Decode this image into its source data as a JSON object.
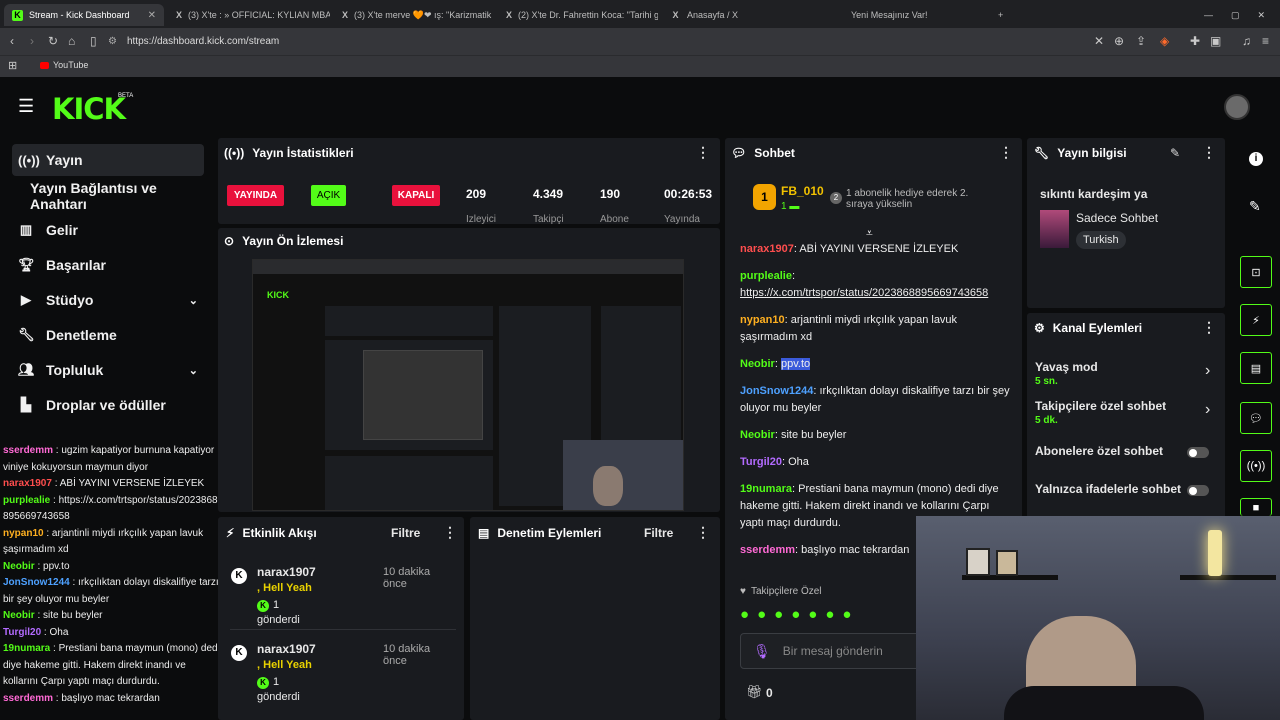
{
  "browser": {
    "tabs": [
      {
        "title": "Stream - Kick Dashboard",
        "active": true
      },
      {
        "title": "(3) X'te : » OFFICIAL: KYLIAN MBA"
      },
      {
        "title": "(3) X'te merve 🧡❤ ış: \"Karizmatik Ce"
      },
      {
        "title": "(2) X'te Dr. Fahrettin Koca: \"Tarihi gal"
      },
      {
        "title": "Anasayfa / X"
      },
      {
        "title": "Yeni Mesajınız Var!"
      }
    ],
    "url": "https://dashboard.kick.com/stream",
    "bookmark": "YouTube"
  },
  "header": {
    "logo": "KICK",
    "beta": "BETA"
  },
  "sidebar": {
    "items": [
      {
        "label": "Yayın"
      },
      {
        "label": "Yayın Bağlantısı ve Anahtarı"
      },
      {
        "label": "Gelir"
      },
      {
        "label": "Başarılar"
      },
      {
        "label": "Stüdyo"
      },
      {
        "label": "Denetleme"
      },
      {
        "label": "Topluluk"
      },
      {
        "label": "Droplar ve ödüller"
      }
    ]
  },
  "stats": {
    "title": "Yayın İstatistikleri",
    "live": "YAYINDA",
    "open": "AÇIK",
    "closed": "KAPALI",
    "viewers": "209",
    "viewers_label": "İzleyici",
    "followers": "4.349",
    "followers_label": "Takipçi",
    "subs": "190",
    "subs_label": "Abone",
    "duration": "00:26:53",
    "duration_label": "Yayında"
  },
  "preview": {
    "title": "Yayın Ön İzlemesi"
  },
  "events": {
    "title": "Etkinlik Akışı",
    "filter": "Filtre",
    "items": [
      {
        "user": "narax1907",
        "time": "10 dakika önce",
        "kicks": "Hell Yeah",
        "count": "1",
        "sent": "gönderdi"
      },
      {
        "user": "narax1907",
        "time": "10 dakika önce",
        "kicks": "Hell Yeah",
        "count": "1",
        "sent": "gönderdi"
      }
    ]
  },
  "moderation": {
    "title": "Denetim Eylemleri",
    "filter": "Filtre"
  },
  "chat": {
    "title": "Sohbet",
    "pinned_user": "FB_010",
    "pinned_count": "1",
    "pinned_text": "1 abonelik hediye ederek 2. sıraya yükselin",
    "messages": [
      {
        "user": "narax1907",
        "text": "ABİ YAYINI VERSENE İZLEYEK",
        "color": "#ff4e4e"
      },
      {
        "user": "purplealie",
        "text": "https://x.com/trtspor/status/2023868895669743658",
        "color": "#53fc18"
      },
      {
        "user": "nypan10",
        "text": "arjantinli miydi ırkçılık yapan lavuk şaşırmadım xd",
        "color": "#ffb020"
      },
      {
        "user": "Neobir",
        "text": "ppv.to",
        "color": "#53fc18"
      },
      {
        "user": "JonSnow1244",
        "text": "ırkçılıktan dolayı diskalifiye tarzı bir şey oluyor mu beyler",
        "color": "#4ea1ff"
      },
      {
        "user": "Neobir",
        "text": "site bu beyler",
        "color": "#53fc18"
      },
      {
        "user": "Turgil20",
        "text": "Oha",
        "color": "#b36bff"
      },
      {
        "user": "19numara",
        "text": "Prestiani bana maymun (mono) dedi diye hakeme gitti. Hakem direkt inandı ve kollarını Çarpı yaptı maçı durdurdu.",
        "color": "#53fc18"
      },
      {
        "user": "sserdemm",
        "text": "başlıyo mac tekrardan",
        "color": "#ff6ad5"
      }
    ],
    "followers_only": "Takipçilere Özel",
    "placeholder": "Bir mesaj gönderin",
    "count": "0"
  },
  "left_chat": [
    {
      "user": "sserdemm",
      "text": "ugzim kapatiyor burnuna kapatiyor viniye kokuyorsun maymun diyor",
      "color": "#ff6ad5"
    },
    {
      "user": "narax1907",
      "text": "ABİ YAYINI VERSENE İZLEYEK",
      "color": "#ff4e4e"
    },
    {
      "user": "purplealie",
      "text": "https://x.com/trtspor/status/2023868895669743658",
      "color": "#53fc18"
    },
    {
      "user": "nypan10",
      "text": "arjantinli miydi ırkçılık yapan lavuk şaşırmadım xd",
      "color": "#ffb020"
    },
    {
      "user": "Neobir",
      "text": "ppv.to",
      "color": "#53fc18"
    },
    {
      "user": "JonSnow1244",
      "text": "ırkçılıktan dolayı diskalifiye tarzı bir şey oluyor mu beyler",
      "color": "#4ea1ff"
    },
    {
      "user": "Neobir",
      "text": "site bu beyler",
      "color": "#53fc18"
    },
    {
      "user": "Turgil20",
      "text": "Oha",
      "color": "#b36bff"
    },
    {
      "user": "19numara",
      "text": "Prestiani bana maymun (mono) dedi diye hakeme gitti. Hakem direkt inandı ve kollarını Çarpı yaptı maçı durdurdu.",
      "color": "#53fc18"
    },
    {
      "user": "sserdemm",
      "text": "başlıyo mac tekrardan",
      "color": "#ff6ad5"
    }
  ],
  "info": {
    "title": "Yayın bilgisi",
    "stream_title": "sıkıntı kardeşim ya",
    "category": "Sadece Sohbet",
    "language": "Turkish"
  },
  "actions": {
    "title": "Kanal Eylemleri",
    "slow_mode": "Yavaş mod",
    "slow_value": "5 sn.",
    "followers_chat": "Takipçilere özel sohbet",
    "followers_value": "5 dk.",
    "subs_chat": "Abonelere özel sohbet",
    "emote_chat": "Yalnızca ifadelerle sohbet"
  },
  "colors": {
    "accent": "#53fc18",
    "live": "#e9113c",
    "panel": "#191b1f"
  }
}
